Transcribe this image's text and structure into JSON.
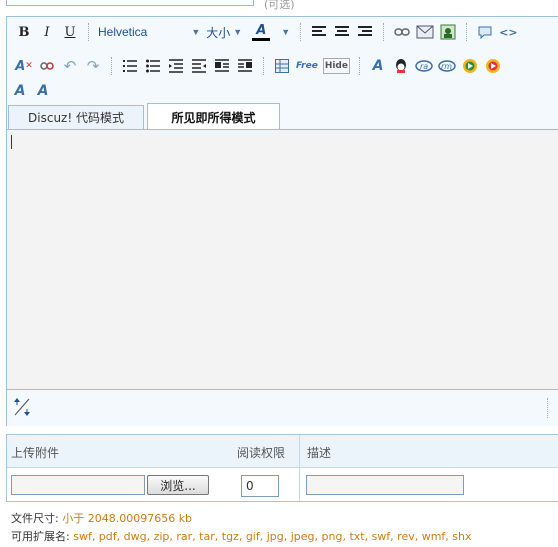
{
  "top_hint": "(可选)",
  "toolbar": {
    "bold": "B",
    "italic": "I",
    "underline": "U",
    "font_family": "Helvetica",
    "font_size": "大小",
    "font_color": "A",
    "free_label": "Free",
    "hide_label": "Hide"
  },
  "tabs": {
    "code_mode": "Discuz! 代码模式",
    "wysiwyg_mode": "所见即所得模式"
  },
  "attachments": {
    "col_upload": "上传附件",
    "col_permission": "阅读权限",
    "col_description": "描述",
    "browse_button": "浏览...",
    "permission_value": "0",
    "file_size_label": "文件尺寸:",
    "file_size_value": "小于  2048.00097656 kb",
    "extensions_label": "可用扩展名:",
    "extensions_value": "swf, pdf, dwg, zip, rar, tar, tgz, gif, jpg, jpeg, png, txt, swf, rev, wmf, shx"
  },
  "colors": {
    "accent_blue": "#1d4f91",
    "border": "#9bc0dd",
    "orange": "#d07b12"
  }
}
